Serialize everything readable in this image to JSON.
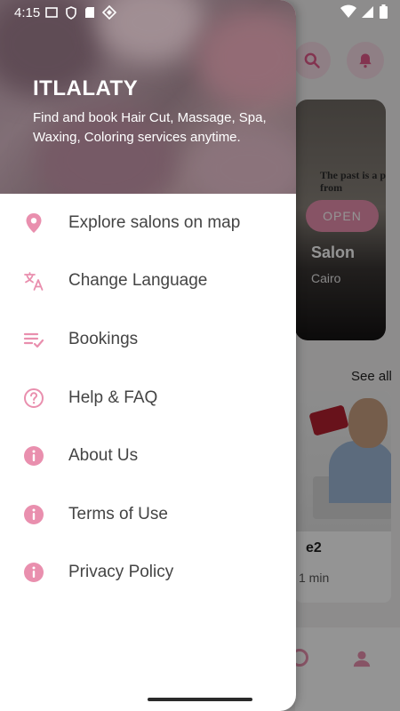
{
  "status_bar": {
    "time": "4:15",
    "left_icons": [
      "screen-icon",
      "shield-icon",
      "sd-card-icon",
      "diamond-icon"
    ],
    "right_icons": [
      "wifi-icon",
      "signal-icon",
      "battery-icon"
    ]
  },
  "background": {
    "quote": "The past is a pl to learn from",
    "open_badge": "OPEN",
    "salon_name": "Salon",
    "salon_city": "Cairo",
    "see_all": "See all",
    "card_title": "e2",
    "card_time": "1 min"
  },
  "drawer": {
    "app_name": "ITLALATY",
    "tagline": "Find and book Hair Cut, Massage, Spa, Waxing, Coloring services anytime.",
    "menu": [
      {
        "label": "Explore salons on map",
        "icon": "location-pin-icon"
      },
      {
        "label": "Change Language",
        "icon": "translate-icon"
      },
      {
        "label": "Bookings",
        "icon": "bookings-list-icon"
      },
      {
        "label": "Help & FAQ",
        "icon": "help-icon"
      },
      {
        "label": "About Us",
        "icon": "info-icon"
      },
      {
        "label": "Terms of Use",
        "icon": "info-icon"
      },
      {
        "label": "Privacy Policy",
        "icon": "info-icon"
      }
    ]
  },
  "colors": {
    "accent": "#e98fae",
    "menu_text": "#444444",
    "drawer_bg": "#ffffff"
  }
}
